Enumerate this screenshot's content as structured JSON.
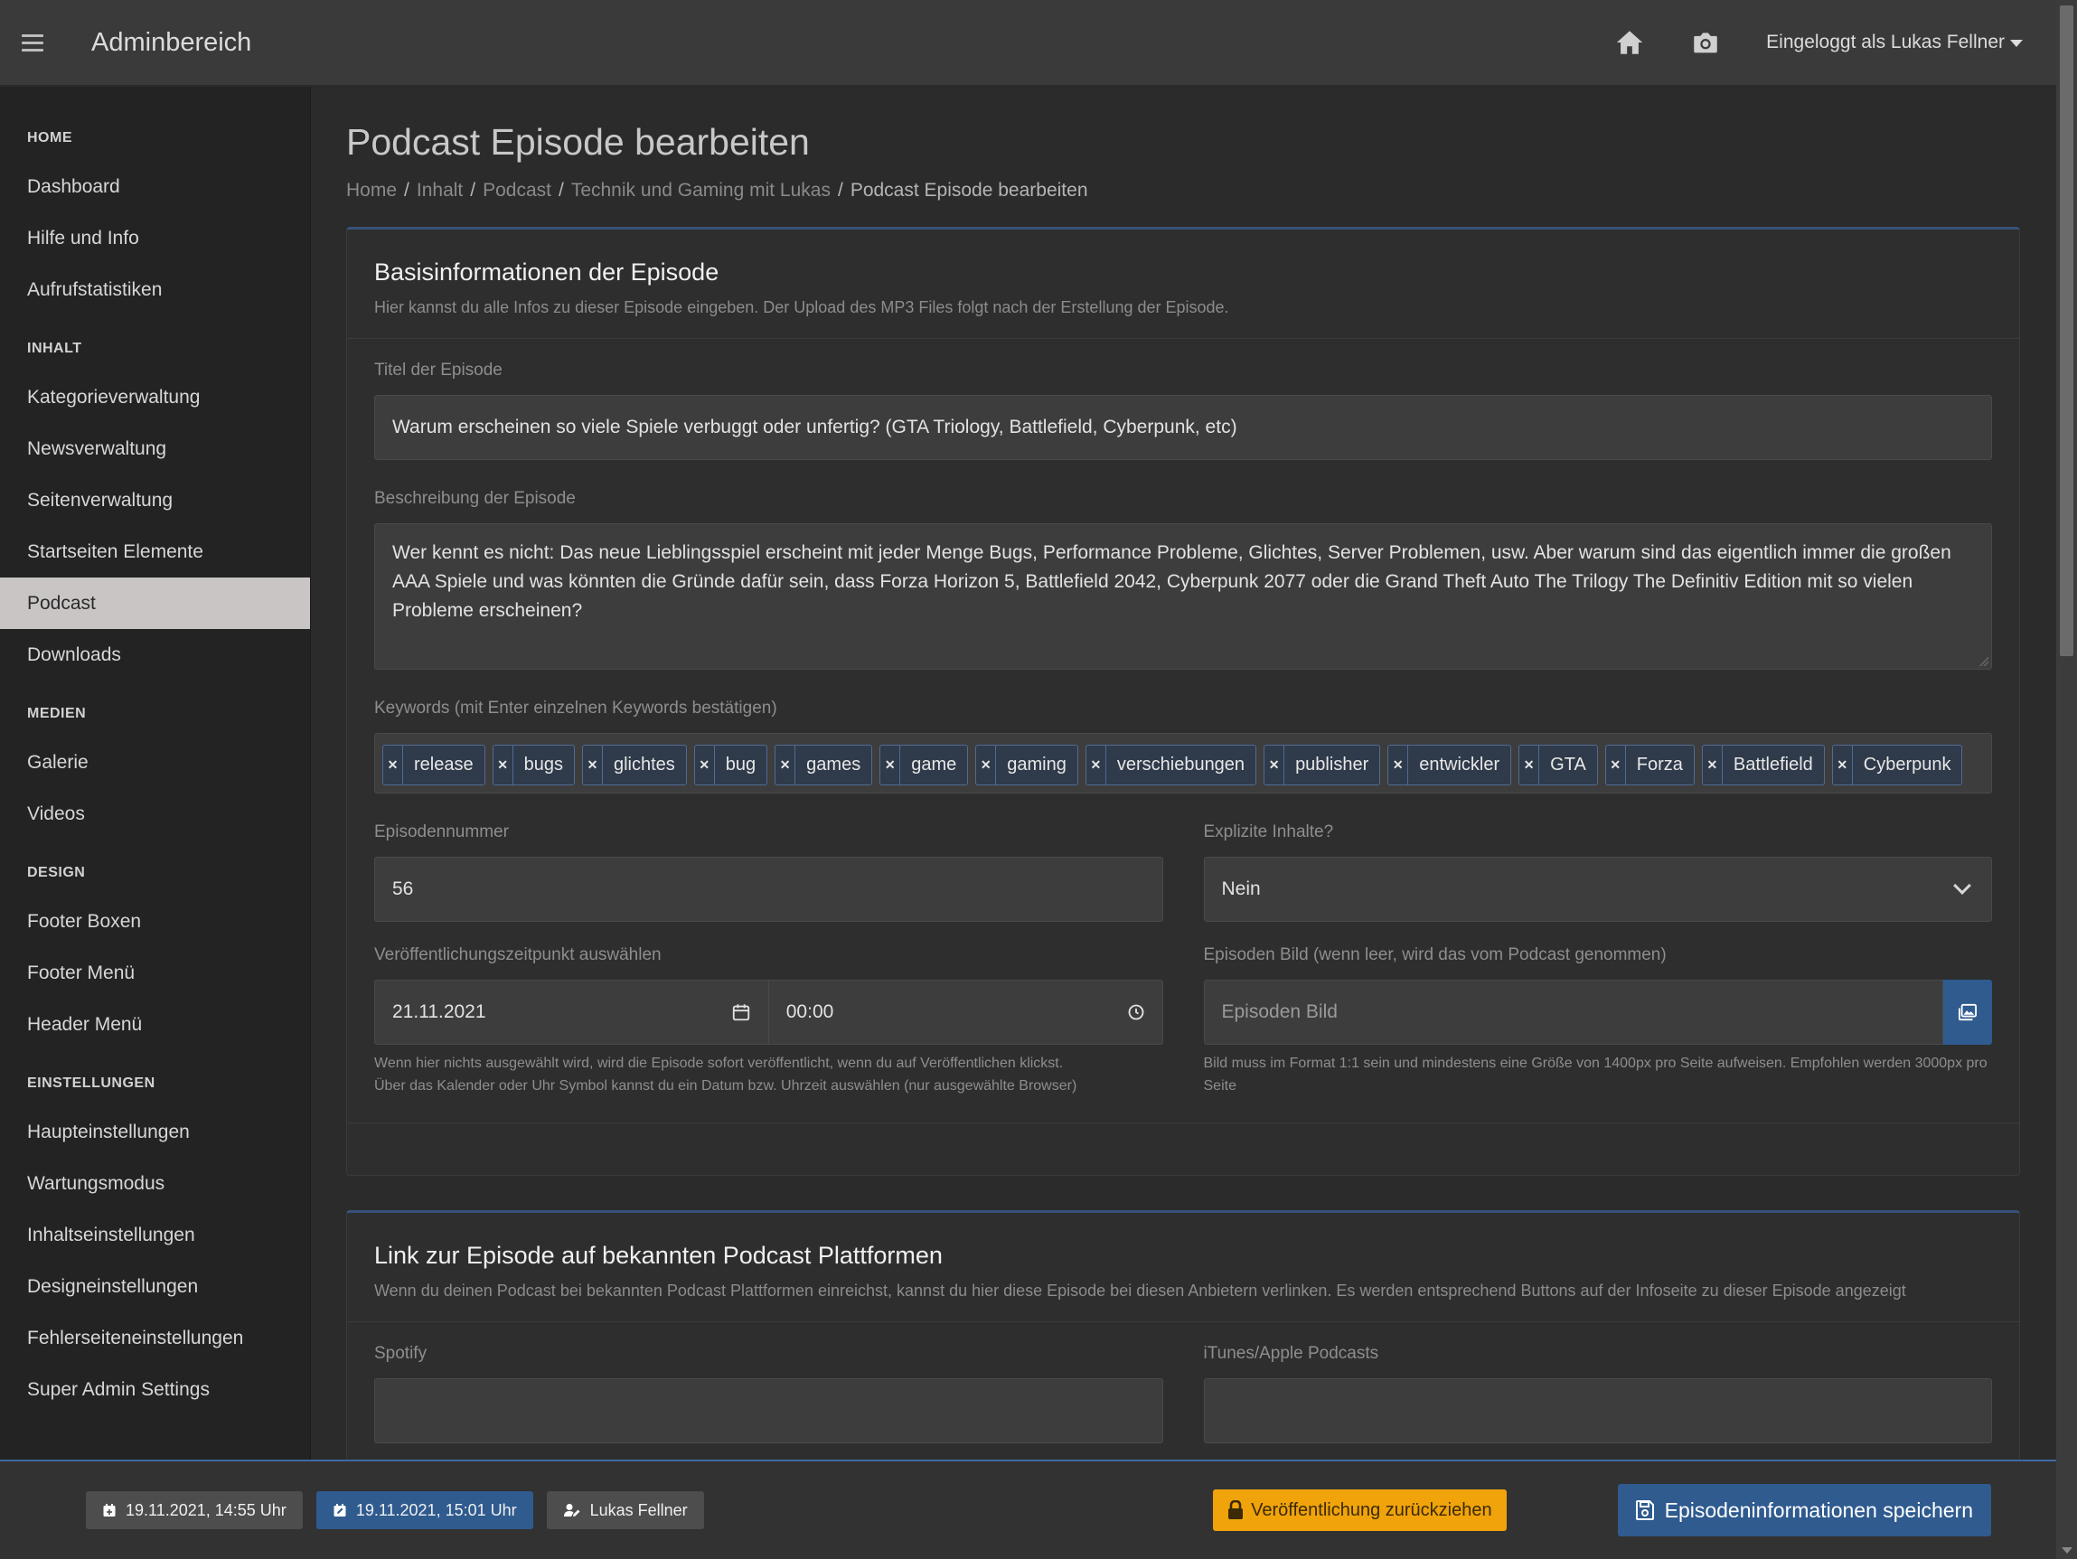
{
  "topbar": {
    "brand": "Adminbereich",
    "user_label": "Eingeloggt als Lukas Fellner"
  },
  "sidebar": {
    "sections": [
      {
        "title": "HOME",
        "items": [
          "Dashboard",
          "Hilfe und Info",
          "Aufrufstatistiken"
        ]
      },
      {
        "title": "INHALT",
        "items": [
          "Kategorieverwaltung",
          "Newsverwaltung",
          "Seitenverwaltung",
          "Startseiten Elemente",
          "Podcast",
          "Downloads"
        ]
      },
      {
        "title": "MEDIEN",
        "items": [
          "Galerie",
          "Videos"
        ]
      },
      {
        "title": "DESIGN",
        "items": [
          "Footer Boxen",
          "Footer Menü",
          "Header Menü"
        ]
      },
      {
        "title": "EINSTELLUNGEN",
        "items": [
          "Haupteinstellungen",
          "Wartungsmodus",
          "Inhaltseinstellungen",
          "Designeinstellungen",
          "Fehlerseiteneinstellungen",
          "Super Admin Settings"
        ]
      }
    ],
    "active_item": "Podcast"
  },
  "page": {
    "title": "Podcast Episode bearbeiten",
    "breadcrumb": [
      "Home",
      "Inhalt",
      "Podcast",
      "Technik und Gaming mit Lukas"
    ],
    "breadcrumb_current": "Podcast Episode bearbeiten"
  },
  "basis": {
    "title": "Basisinformationen der Episode",
    "subtitle": "Hier kannst du alle Infos zu dieser Episode eingeben. Der Upload des MP3 Files folgt nach der Erstellung der Episode.",
    "title_label": "Titel der Episode",
    "title_value": "Warum erscheinen so viele Spiele verbuggt oder unfertig? (GTA Triology, Battlefield, Cyberpunk, etc)",
    "desc_label": "Beschreibung der Episode",
    "desc_value": "Wer kennt es nicht: Das neue Lieblingsspiel erscheint mit jeder Menge Bugs, Performance Probleme, Glichtes, Server Problemen, usw. Aber warum sind das eigentlich immer die großen AAA Spiele und was könnten die Gründe dafür sein, dass Forza Horizon 5, Battlefield 2042, Cyberpunk 2077 oder die Grand Theft Auto The Trilogy The Definitiv Edition mit so vielen Probleme erscheinen?",
    "keywords_label": "Keywords (mit Enter einzelnen Keywords bestätigen)",
    "keywords": [
      "release",
      "bugs",
      "glichtes",
      "bug",
      "games",
      "game",
      "gaming",
      "verschiebungen",
      "publisher",
      "entwickler",
      "GTA",
      "Forza",
      "Battlefield",
      "Cyberpunk"
    ],
    "episode_number_label": "Episodennummer",
    "episode_number": "56",
    "explicit_label": "Explizite Inhalte?",
    "explicit_value": "Nein",
    "publish_label": "Veröffentlichungszeitpunkt auswählen",
    "publish_date": "21.11.2021",
    "publish_time": "00:00",
    "publish_help_1": "Wenn hier nichts ausgewählt wird, wird die Episode sofort veröffentlicht, wenn du auf Veröffentlichen klickst.",
    "publish_help_2": "Über das Kalender oder Uhr Symbol kannst du ein Datum bzw. Uhrzeit auswählen (nur ausgewählte Browser)",
    "image_label": "Episoden Bild (wenn leer, wird das vom Podcast genommen)",
    "image_placeholder": "Episoden Bild",
    "image_help": "Bild muss im Format 1:1 sein und mindestens eine Größe von 1400px pro Seite aufweisen. Empfohlen werden 3000px pro Seite"
  },
  "links": {
    "title": "Link zur Episode auf bekannten Podcast Plattformen",
    "subtitle": "Wenn du deinen Podcast bei bekannten Podcast Plattformen einreichst, kannst du hier diese Episode bei diesen Anbietern verlinken. Es werden entsprechend Buttons auf der Infoseite zu dieser Episode angezeigt",
    "spotify_label": "Spotify",
    "itunes_label": "iTunes/Apple Podcasts"
  },
  "bottombar": {
    "created": "19.11.2021, 14:55 Uhr",
    "modified": "19.11.2021, 15:01 Uhr",
    "author": "Lukas Fellner",
    "unpublish_label": "Veröffentlichung zurückziehen",
    "save_label": "Episodeninformationen speichern"
  },
  "colors": {
    "accent": "#2f5b8f",
    "warning": "#f0a30a",
    "active_nav": "#c9c5c5"
  }
}
